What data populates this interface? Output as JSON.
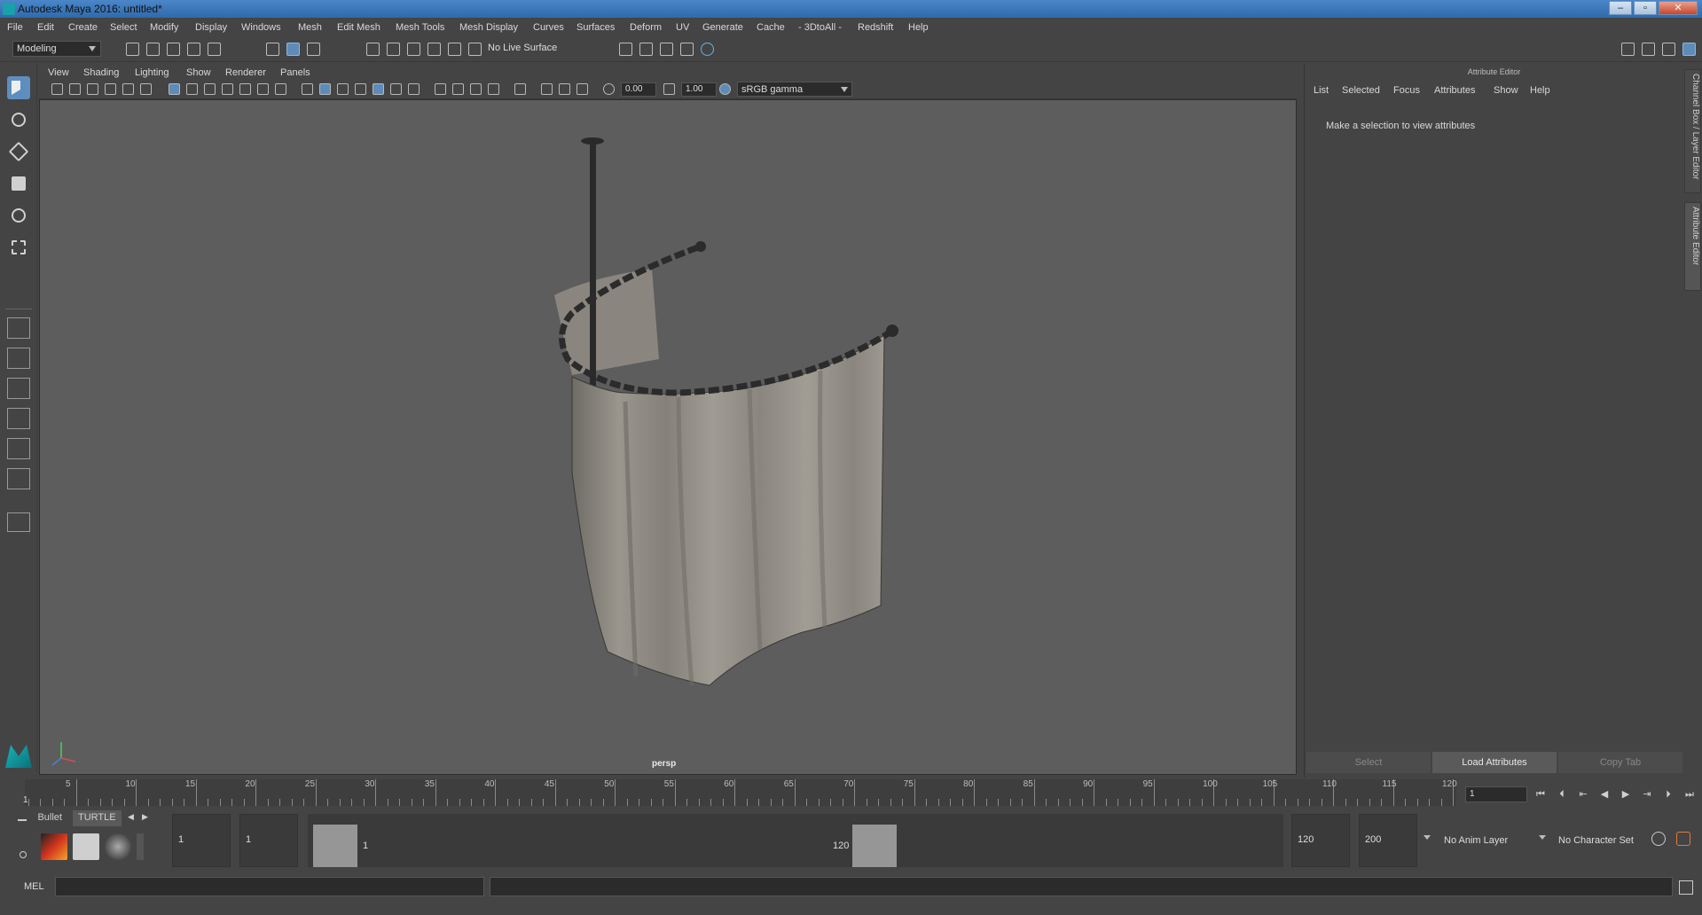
{
  "window": {
    "title": "Autodesk Maya 2016: untitled*",
    "controls": [
      "–",
      "▫",
      "✕"
    ]
  },
  "menubar": {
    "items": [
      "File",
      "Edit",
      "Create",
      "Select",
      "Modify",
      "Display",
      "Windows",
      "Mesh",
      "Edit Mesh",
      "Mesh Tools",
      "Mesh Display",
      "Curves",
      "Surfaces",
      "Deform",
      "UV",
      "Generate",
      "Cache",
      "- 3DtoAll -",
      "Redshift",
      "Help"
    ]
  },
  "toolbar": {
    "workspace": "Modeling",
    "live_surface": "No Live Surface"
  },
  "viewport": {
    "menu": [
      "View",
      "Shading",
      "Lighting",
      "Show",
      "Renderer",
      "Panels"
    ],
    "exposure": "0.00",
    "gamma_value": "1.00",
    "color_space": "sRGB gamma",
    "camera_label": "persp"
  },
  "attribute_editor": {
    "title": "Attribute Editor",
    "tabs": [
      "List",
      "Selected",
      "Focus",
      "Attributes",
      "Show",
      "Help"
    ],
    "message": "Make a selection to view attributes",
    "buttons": {
      "select": "Select",
      "load": "Load Attributes",
      "copy": "Copy Tab"
    }
  },
  "side_tabs": {
    "channel_box": "Channel Box / Layer Editor",
    "attribute_editor": "Attribute Editor"
  },
  "timeline": {
    "start_label": "1",
    "ticks": [
      "5",
      "10",
      "15",
      "20",
      "25",
      "30",
      "35",
      "40",
      "45",
      "50",
      "55",
      "60",
      "65",
      "70",
      "75",
      "80",
      "85",
      "90",
      "95",
      "100",
      "105",
      "110",
      "115",
      "120"
    ],
    "current_frame": "1"
  },
  "range": {
    "shelf_tabs": [
      "Bullet",
      "TURTLE"
    ],
    "start_time": "1",
    "playback_start": "1",
    "range_start_label": "1",
    "range_end_label": "120",
    "playback_end": "120",
    "end_time": "200",
    "anim_layer": "No Anim Layer",
    "character_set": "No Character Set"
  },
  "commandline": {
    "language": "MEL"
  },
  "colors": {
    "background": "#444444",
    "viewport": "#5d5d5d",
    "accent": "#5d8ec0",
    "titlebar": "#3a76bb"
  }
}
